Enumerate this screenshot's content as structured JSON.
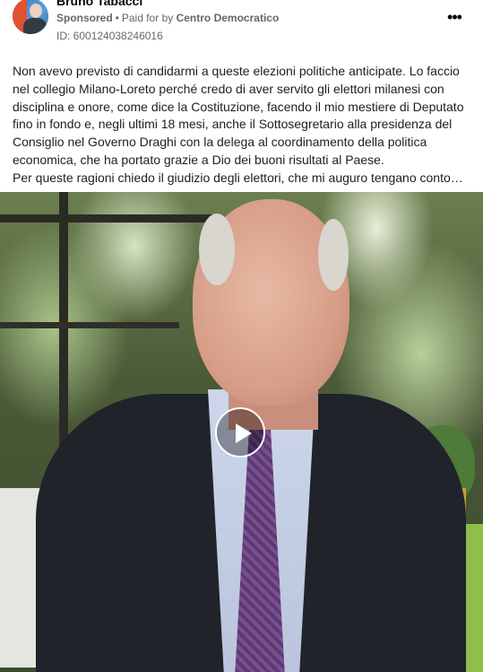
{
  "post": {
    "author": "Bruno Tabacci",
    "sponsored_label": "Sponsored",
    "separator": "•",
    "paid_for_prefix": "Paid for by",
    "payer": "Centro Democratico",
    "ad_id": "ID: 600124038246016",
    "more_icon": "more-options-icon",
    "body_paragraph_1": "Non avevo previsto di candidarmi a queste elezioni politiche anticipate. Lo faccio nel collegio Milano-Loreto perché credo di aver servito gli elettori milanesi con disciplina e onore, come dice la Costituzione, facendo il mio mestiere di Deputato fino in fondo e, negli ultimi 18 mesi, anche il Sottosegretario alla presidenza del Consiglio nel Governo Draghi con la delega al coordinamento della politica economica, che ha portato grazie a Dio dei buoni risultati al Paese.",
    "body_paragraph_2": "Per queste ragioni chiedo il giudizio degli elettori, che mi auguro tengano conto…"
  },
  "video": {
    "play_icon": "play-icon"
  },
  "colors": {
    "text_primary": "#1c1e21",
    "text_secondary": "#65676b",
    "background": "#ffffff"
  }
}
